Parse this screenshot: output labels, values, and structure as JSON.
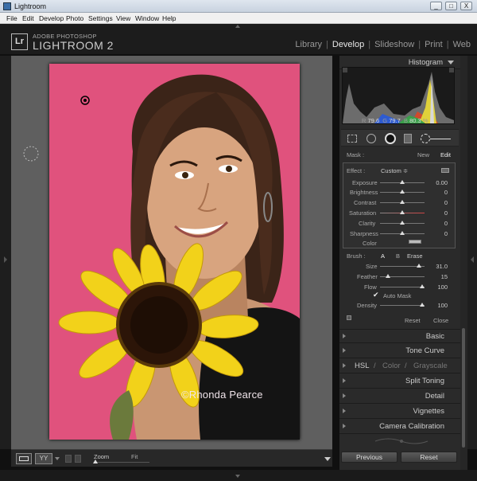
{
  "window": {
    "title": "Lightroom",
    "min": "_",
    "max": "□",
    "close": "X"
  },
  "menu": [
    "File",
    "Edit",
    "Develop",
    "Photo",
    "Settings",
    "View",
    "Window",
    "Help"
  ],
  "brand": {
    "logo": "Lr",
    "line1": "ADOBE PHOTOSHOP",
    "line2": "LIGHTROOM 2"
  },
  "modules": [
    "Library",
    "Develop",
    "Slideshow",
    "Print",
    "Web"
  ],
  "active_module": "Develop",
  "photo": {
    "watermark": "©Rhonda Pearce"
  },
  "toolbar": {
    "zoom_label": "Zoom",
    "fit_label": "Fit",
    "compare_label": "YY"
  },
  "histogram": {
    "title": "Histogram",
    "r_label": "R",
    "r": "79.6",
    "g_label": "G",
    "g": "79.7",
    "b_label": "B",
    "b": "80.3",
    "pct": "%"
  },
  "mask": {
    "label": "Mask :",
    "new": "New",
    "edit": "Edit"
  },
  "effect": {
    "label": "Effect :",
    "preset": "Custom ≑",
    "sliders": [
      {
        "name": "Exposure",
        "value": "0.00"
      },
      {
        "name": "Brightness",
        "value": "0"
      },
      {
        "name": "Contrast",
        "value": "0"
      },
      {
        "name": "Saturation",
        "value": "0"
      },
      {
        "name": "Clarity",
        "value": "0"
      },
      {
        "name": "Sharpness",
        "value": "0"
      }
    ],
    "color_label": "Color"
  },
  "brush": {
    "label": "Brush :",
    "a": "A",
    "b": "B",
    "erase": "Erase",
    "sliders": [
      {
        "name": "Size",
        "value": "31.0"
      },
      {
        "name": "Feather",
        "value": "15"
      },
      {
        "name": "Flow",
        "value": "100"
      }
    ],
    "automask": "Auto Mask",
    "density_label": "Density",
    "density": "100",
    "reset": "Reset",
    "close": "Close"
  },
  "panels": {
    "basic": "Basic",
    "tonecurve": "Tone Curve",
    "hsl": "HSL",
    "color": "Color",
    "grayscale": "Grayscale",
    "split": "Split Toning",
    "detail": "Detail",
    "vignettes": "Vignettes",
    "calib": "Camera Calibration"
  },
  "buttons": {
    "previous": "Previous",
    "reset": "Reset"
  },
  "colors": {
    "photo_bg": "#e0527d",
    "panel": "#2a2a2a",
    "canvas": "#5f5f5f"
  }
}
